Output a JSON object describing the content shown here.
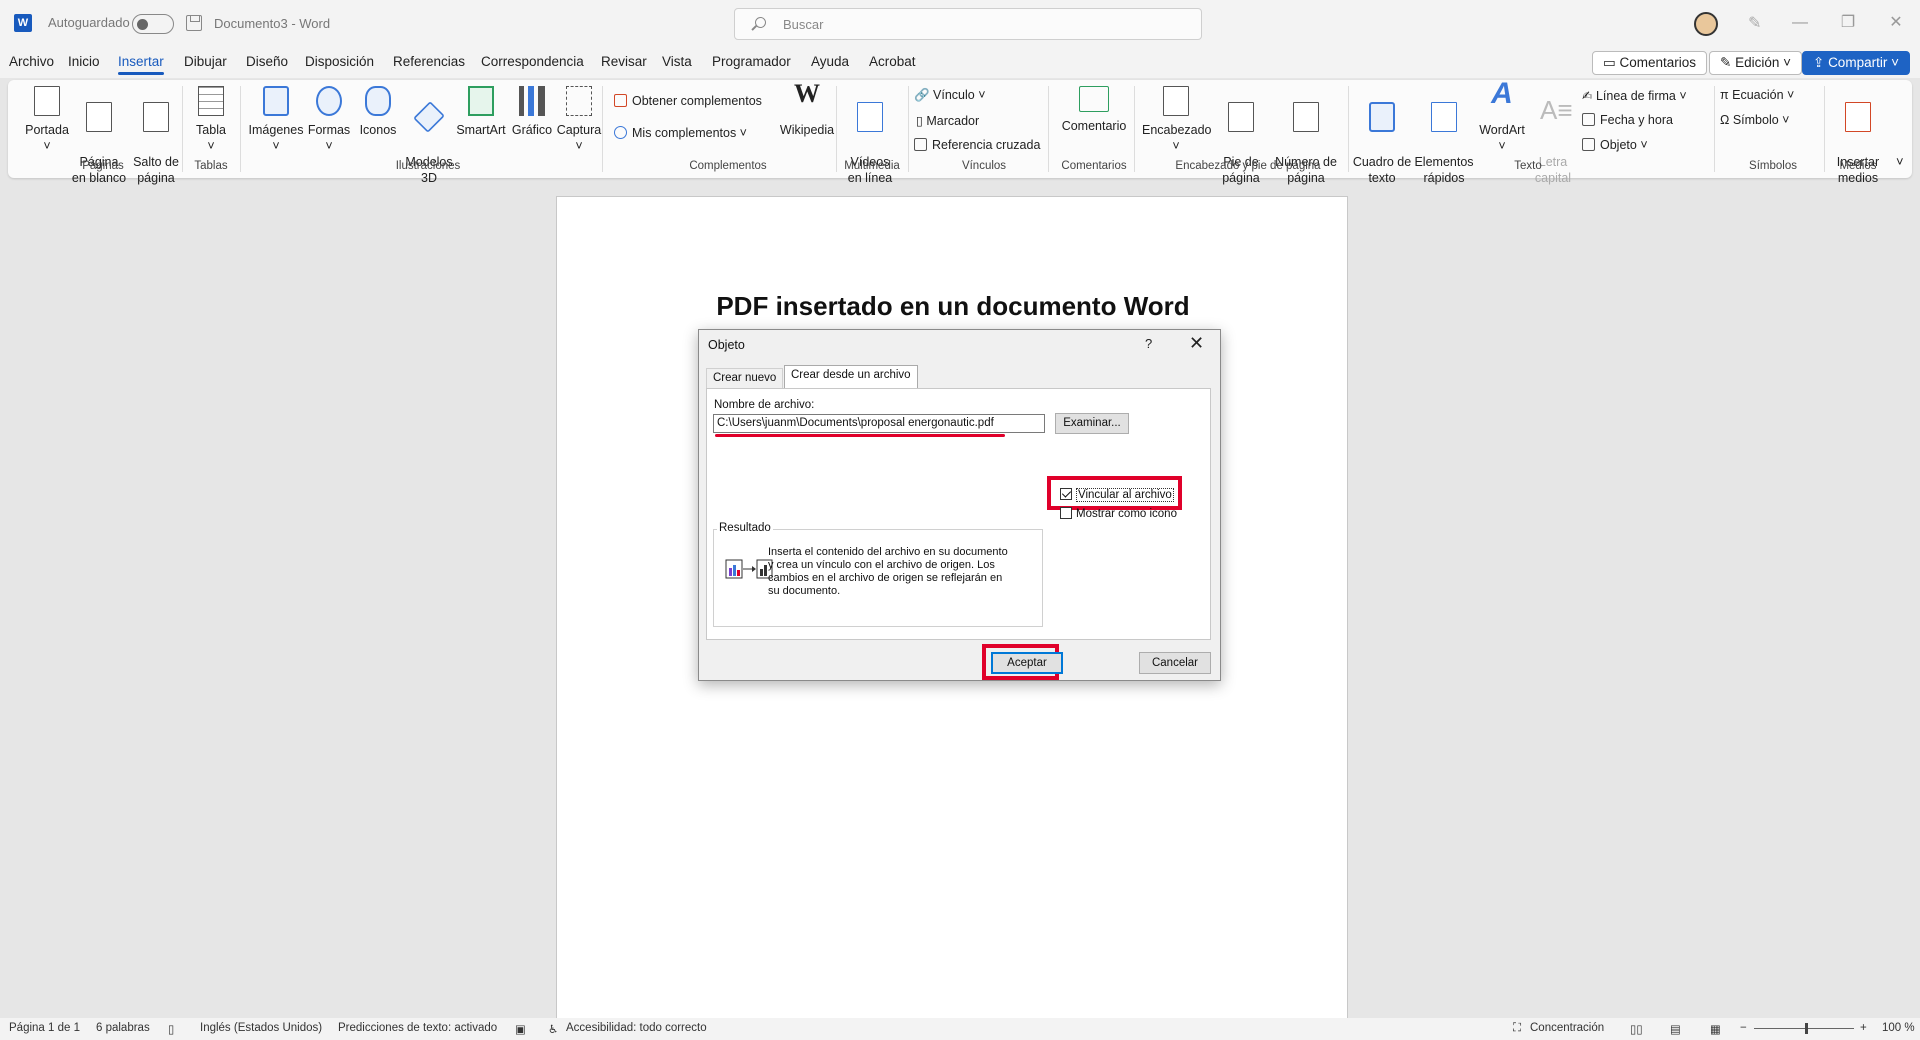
{
  "titlebar": {
    "autosave_label": "Autoguardado",
    "doc_title": "Documento3  -  Word",
    "search_placeholder": "Buscar"
  },
  "menu": {
    "tabs": [
      "Archivo",
      "Inicio",
      "Insertar",
      "Dibujar",
      "Diseño",
      "Disposición",
      "Referencias",
      "Correspondencia",
      "Revisar",
      "Vista",
      "Programador",
      "Ayuda",
      "Acrobat"
    ],
    "active_tab": "Insertar",
    "comments_label": "Comentarios",
    "editing_label": "Edición",
    "share_label": "Compartir"
  },
  "ribbon": {
    "paginas": {
      "portada": "Portada",
      "pagina_en_blanco": "Página\nen blanco",
      "salto": "Salto de\npágina",
      "label": "Páginas"
    },
    "tablas": {
      "tabla": "Tabla",
      "label": "Tablas"
    },
    "ilustraciones": {
      "imagenes": "Imágenes",
      "formas": "Formas",
      "iconos": "Iconos",
      "modelos3d": "Modelos\n3D",
      "smartart": "SmartArt",
      "grafico": "Gráfico",
      "captura": "Captura",
      "label": "Ilustraciones"
    },
    "complementos": {
      "obtener": "Obtener complementos",
      "mis": "Mis complementos",
      "wikipedia": "Wikipedia",
      "label": "Complementos"
    },
    "multimedia": {
      "videos": "Vídeos\nen línea",
      "label": "Multimedia"
    },
    "vinculos": {
      "vinculo": "Vínculo",
      "marcador": "Marcador",
      "referencia": "Referencia cruzada",
      "label": "Vínculos"
    },
    "comentarios": {
      "comentario": "Comentario",
      "label": "Comentarios"
    },
    "encabezado": {
      "encabezado": "Encabezado",
      "pie": "Pie de\npágina",
      "numero": "Número de\npágina",
      "label": "Encabezado y pie de página"
    },
    "texto": {
      "cuadro": "Cuadro de\ntexto",
      "elementos": "Elementos\nrápidos",
      "wordart": "WordArt",
      "letra_capital": "Letra\ncapital",
      "linea_firma": "Línea de firma",
      "fecha_hora": "Fecha y hora",
      "objeto": "Objeto",
      "label": "Texto"
    },
    "simbolos": {
      "ecuacion": "Ecuación",
      "simbolo": "Símbolo",
      "label": "Símbolos"
    },
    "medios": {
      "insertar": "Insertar\nmedios",
      "label": "Medios"
    }
  },
  "document": {
    "heading": "PDF insertado en un documento Word"
  },
  "dialog": {
    "title": "Objeto",
    "help": "?",
    "tabs": [
      "Crear nuevo",
      "Crear desde un archivo"
    ],
    "selected_tab": "Crear desde un archivo",
    "filename_label": "Nombre de archivo:",
    "filename_value": "C:\\Users\\juanm\\Documents\\proposal energonautic.pdf",
    "browse_label": "Examinar...",
    "link_label": "Vincular al archivo",
    "link_checked": true,
    "icon_label": "Mostrar como icono",
    "icon_checked": false,
    "result_label": "Resultado",
    "result_text": "Inserta el contenido del archivo en su documento y crea un vínculo con el archivo de origen. Los cambios en el archivo de origen se reflejarán en su documento.",
    "ok_label": "Aceptar",
    "cancel_label": "Cancelar",
    "highlight_color": "#e0002a"
  },
  "statusbar": {
    "page": "Página 1 de 1",
    "words": "6 palabras",
    "language": "Inglés (Estados Unidos)",
    "predictions": "Predicciones de texto: activado",
    "accessibility": "Accesibilidad: todo correcto",
    "focus": "Concentración",
    "zoom": "100 %"
  },
  "colors": {
    "accent": "#185abd",
    "share": "#1e63c4"
  }
}
